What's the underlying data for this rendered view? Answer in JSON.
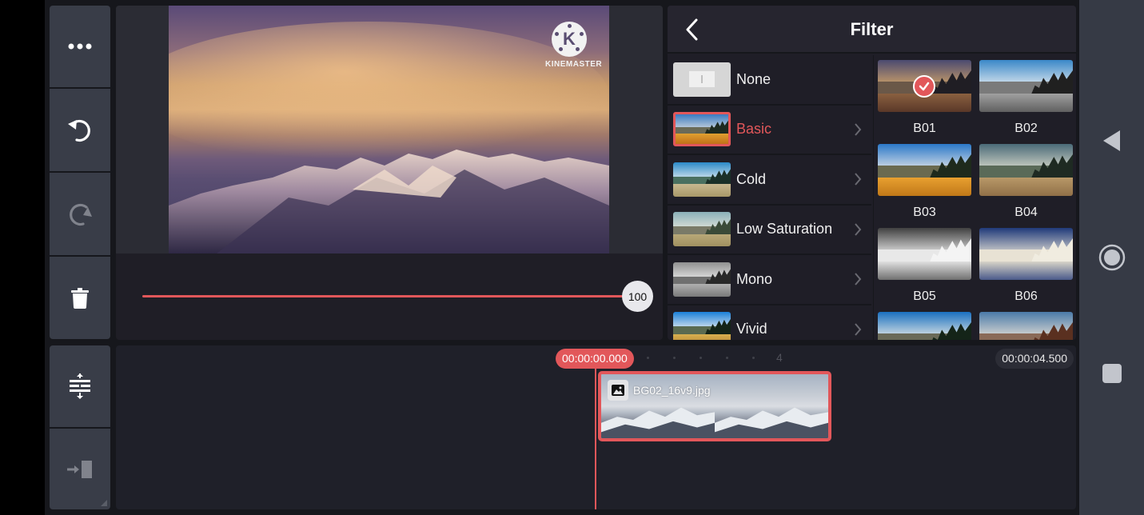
{
  "toolbar_left": {
    "more_label": "More options",
    "undo_label": "Undo",
    "redo_label": "Redo",
    "delete_label": "Delete"
  },
  "toolbar_left_bottom": {
    "expand_label": "Expand timeline",
    "jump_label": "Jump to clip"
  },
  "preview": {
    "logo_text": "KINEMASTER"
  },
  "slider": {
    "value": 100,
    "value_label": "100",
    "min": 0,
    "max": 100,
    "accent": "#e2575a"
  },
  "filter_panel": {
    "title": "Filter",
    "back_label": "Back",
    "categories": [
      {
        "label": "None",
        "active": false
      },
      {
        "label": "Basic",
        "active": true
      },
      {
        "label": "Cold",
        "active": false
      },
      {
        "label": "Low Saturation",
        "active": false
      },
      {
        "label": "Mono",
        "active": false
      },
      {
        "label": "Vivid",
        "active": false
      }
    ],
    "filters": [
      {
        "label": "B01",
        "selected": true
      },
      {
        "label": "B02",
        "selected": false
      },
      {
        "label": "B03",
        "selected": false
      },
      {
        "label": "B04",
        "selected": false
      },
      {
        "label": "B05",
        "selected": false
      },
      {
        "label": "B06",
        "selected": false
      },
      {
        "label": "",
        "selected": false
      },
      {
        "label": "",
        "selected": false
      }
    ]
  },
  "timeline": {
    "current_time": "00:00:00.000",
    "total_time": "00:00:04.500",
    "ruler_label": "4",
    "clip_name": "BG02_16v9.jpg"
  },
  "nav": {
    "back": "back-icon",
    "home": "home-icon",
    "recents": "recents-icon"
  },
  "colors": {
    "accent": "#e2575a",
    "panel": "#1f1e27",
    "toolbar": "#393d48"
  }
}
